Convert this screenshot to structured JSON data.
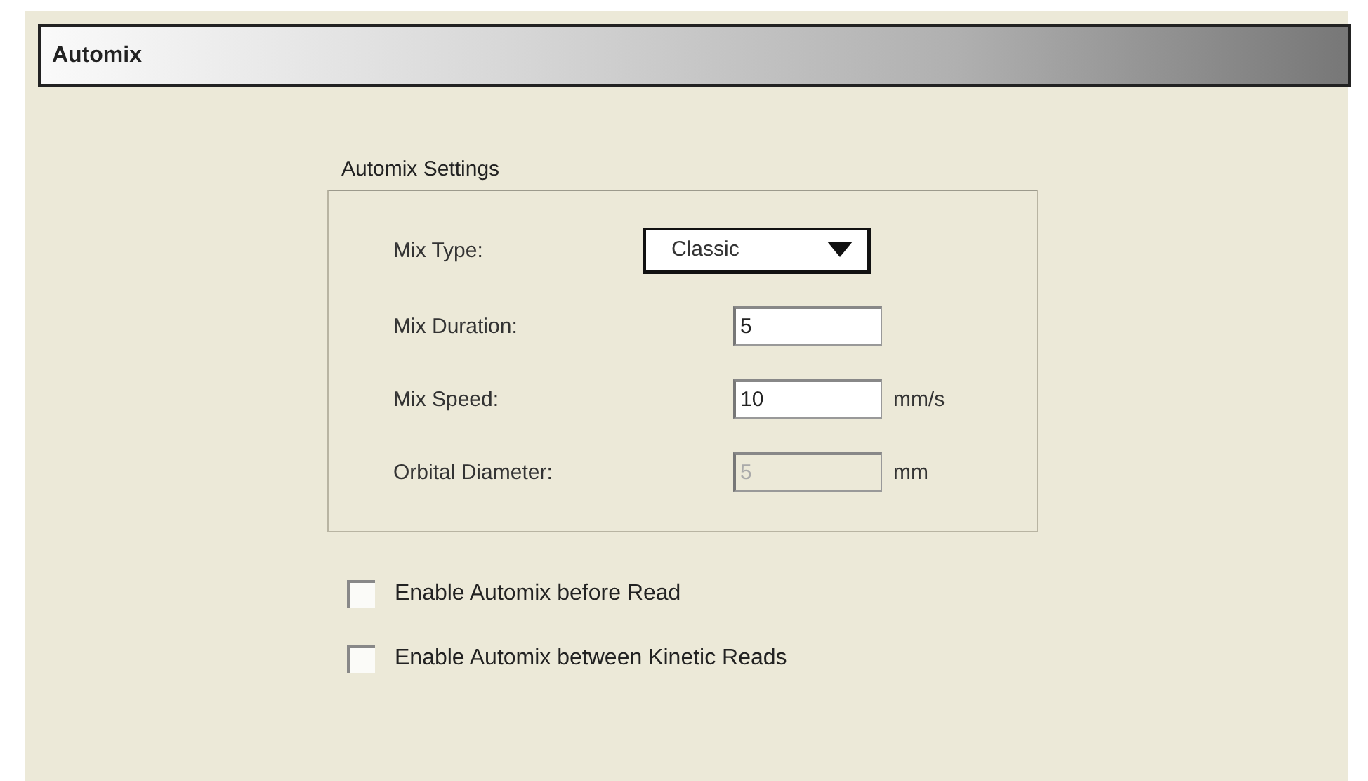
{
  "header": {
    "title": "Automix"
  },
  "group": {
    "title": "Automix Settings",
    "fields": [
      {
        "kind": "dropdown",
        "label": "Mix Type:",
        "value": "Classic",
        "disabled": false
      },
      {
        "kind": "text",
        "label": "Mix Duration:",
        "value": "5",
        "disabled": false
      },
      {
        "kind": "text",
        "label": "Mix Speed:",
        "value": "10",
        "unit": "mm/s",
        "disabled": false
      },
      {
        "kind": "text",
        "label": "Orbital Diameter:",
        "value": "5",
        "unit": "mm",
        "disabled": true
      }
    ]
  },
  "checkboxes": [
    {
      "label": "Enable Automix before Read",
      "checked": false
    },
    {
      "label": "Enable Automix between Kinetic Reads",
      "checked": false
    }
  ]
}
